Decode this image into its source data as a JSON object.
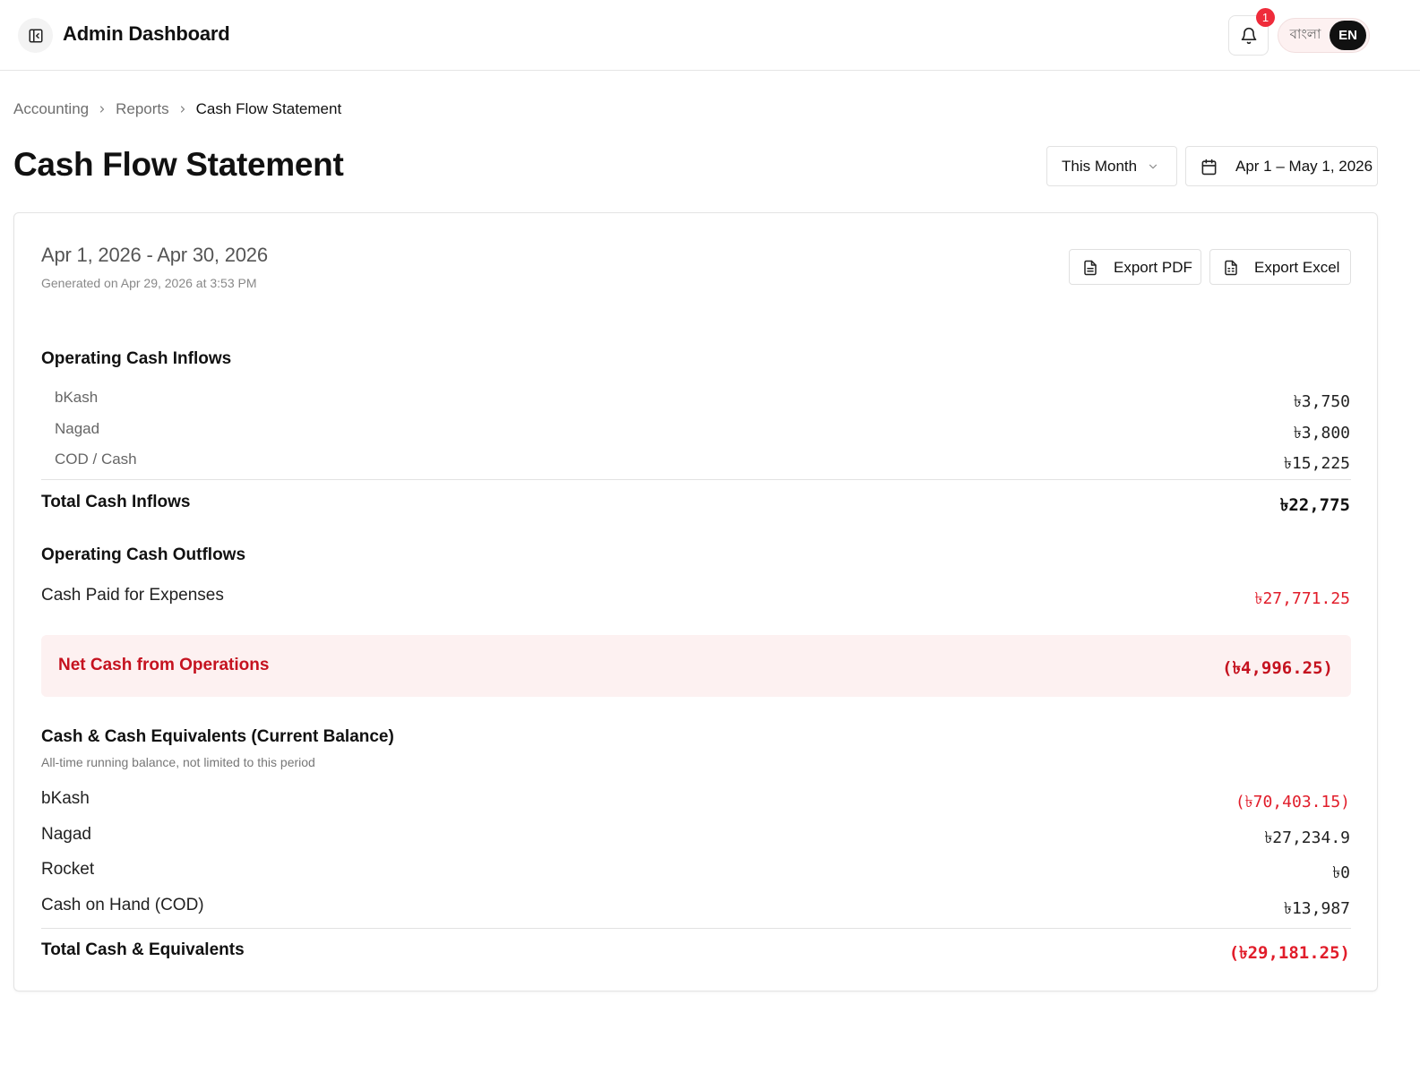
{
  "header": {
    "app_title": "Admin Dashboard",
    "notification_count": "1",
    "lang_bn": "বাংলা",
    "lang_en": "EN"
  },
  "breadcrumb": {
    "items": [
      "Accounting",
      "Reports"
    ],
    "current": "Cash Flow Statement"
  },
  "page": {
    "title": "Cash Flow Statement",
    "period_select": "This Month",
    "date_range": "Apr 1 – May 1, 2026"
  },
  "report": {
    "period": "Apr 1, 2026 - Apr 30, 2026",
    "generated": "Generated on Apr 29, 2026 at 3:53 PM",
    "export_pdf": "Export PDF",
    "export_excel": "Export Excel",
    "inflows": {
      "title": "Operating Cash Inflows",
      "rows": [
        {
          "label": "bKash",
          "amount": "৳3,750"
        },
        {
          "label": "Nagad",
          "amount": "৳3,800"
        },
        {
          "label": "COD / Cash",
          "amount": "৳15,225"
        }
      ],
      "total_label": "Total Cash Inflows",
      "total_amount": "৳22,775"
    },
    "outflows": {
      "title": "Operating Cash Outflows",
      "row_label": "Cash Paid for Expenses",
      "row_amount": "৳27,771.25"
    },
    "net": {
      "label": "Net Cash from Operations",
      "amount": "(৳4,996.25)"
    },
    "balance": {
      "title": "Cash & Cash Equivalents (Current Balance)",
      "note": "All-time running balance, not limited to this period",
      "rows": [
        {
          "label": "bKash",
          "amount": "(৳70,403.15)"
        },
        {
          "label": "Nagad",
          "amount": "৳27,234.9"
        },
        {
          "label": "Rocket",
          "amount": "৳0"
        },
        {
          "label": "Cash on Hand (COD)",
          "amount": "৳13,987"
        }
      ],
      "total_label": "Total Cash & Equivalents",
      "total_amount": "(৳29,181.25)"
    }
  },
  "colors": {
    "negative": "#e11d2a",
    "net_text": "#c5121f",
    "net_bg": "#fdf1f1",
    "badge": "#ef2b3a"
  }
}
